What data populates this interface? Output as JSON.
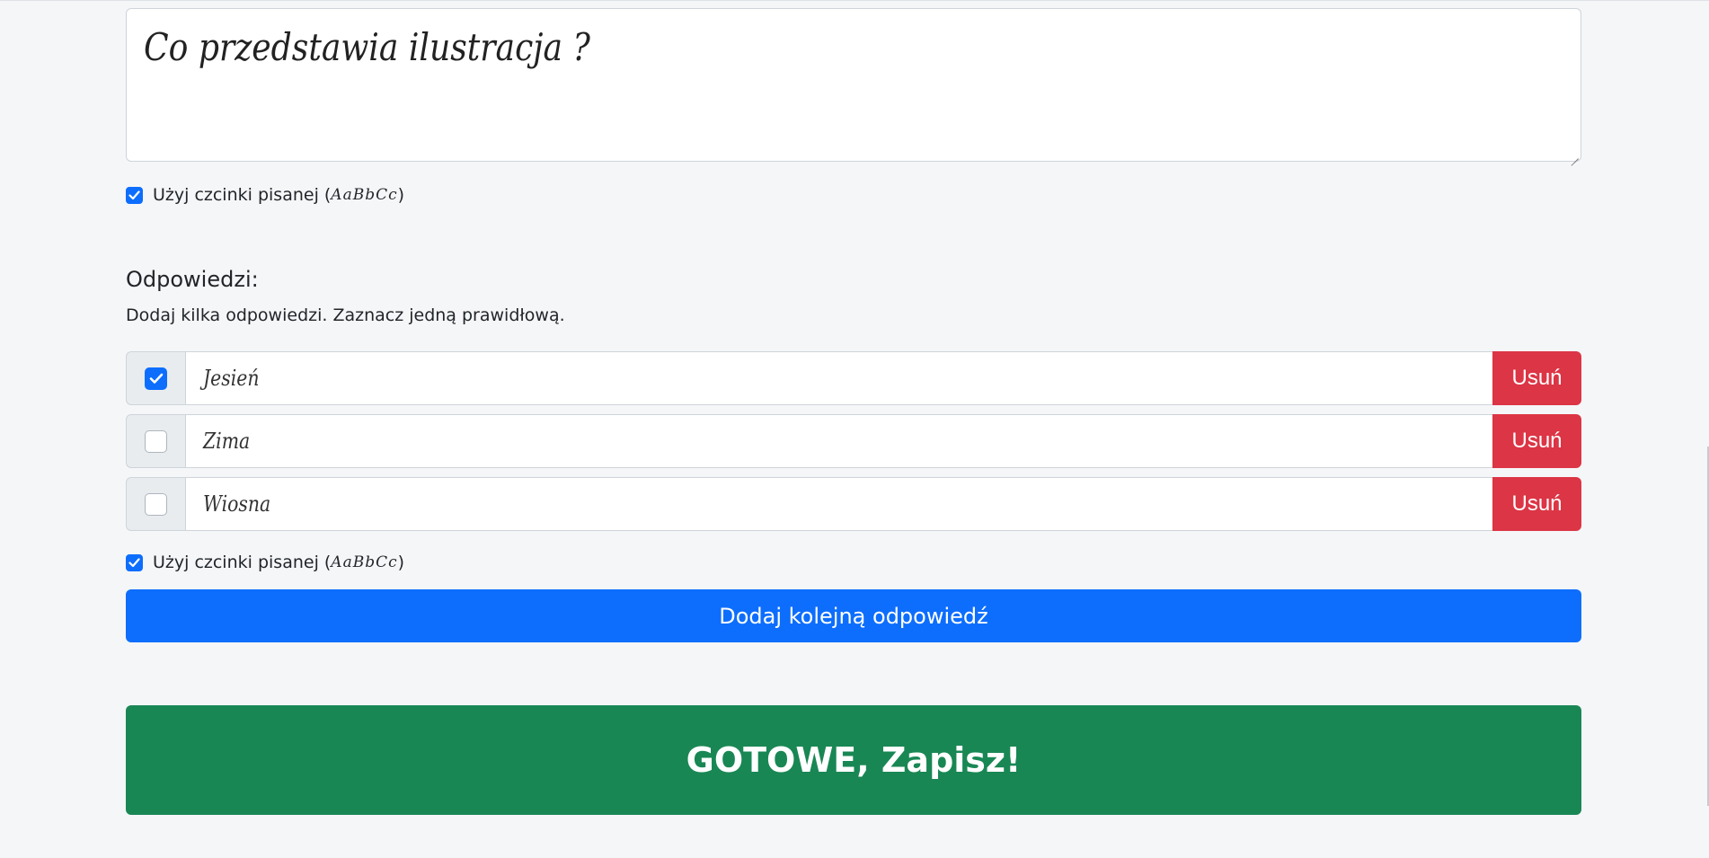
{
  "question": {
    "text": "Co przedstawia ilustracja ?",
    "script_font_enabled": true,
    "script_font_label": "Użyj czcinki pisanej (",
    "script_font_sample": "AaBbCc",
    "script_font_label_end": ")"
  },
  "answers_section": {
    "heading": "Odpowiedzi:",
    "instructions": "Dodaj kilka odpowiedzi. Zaznacz jedną prawidłową.",
    "items": [
      {
        "text": "Jesień",
        "correct": true,
        "remove_label": "Usuń"
      },
      {
        "text": "Zima",
        "correct": false,
        "remove_label": "Usuń"
      },
      {
        "text": "Wiosna",
        "correct": false,
        "remove_label": "Usuń"
      }
    ],
    "script_font_enabled": true,
    "script_font_label": "Użyj czcinki pisanej (",
    "script_font_sample": "AaBbCc",
    "script_font_label_end": ")",
    "add_label": "Dodaj kolejną odpowiedź"
  },
  "save_label": "GOTOWE, Zapisz!",
  "colors": {
    "primary": "#0d6efd",
    "danger": "#dc3545",
    "success": "#198754",
    "background": "#f5f6f8"
  }
}
